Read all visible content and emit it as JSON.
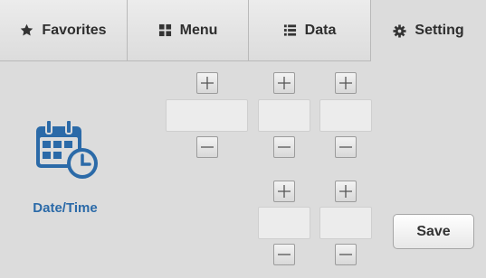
{
  "tabs": [
    {
      "label": "Favorites",
      "icon": "star-icon",
      "active": false
    },
    {
      "label": "Menu",
      "icon": "grid-icon",
      "active": false
    },
    {
      "label": "Data",
      "icon": "list-icon",
      "active": false
    },
    {
      "label": "Setting",
      "icon": "gear-icon",
      "active": true
    }
  ],
  "date": {
    "field1": "",
    "field2": "",
    "field3": ""
  },
  "time": {
    "field1": "",
    "field2": ""
  },
  "sidebar": {
    "label": "Date/Time",
    "icon": "calendar-clock-icon"
  },
  "save_label": "Save",
  "colors": {
    "accent": "#2b6aa8",
    "background": "#dcdcdc"
  }
}
